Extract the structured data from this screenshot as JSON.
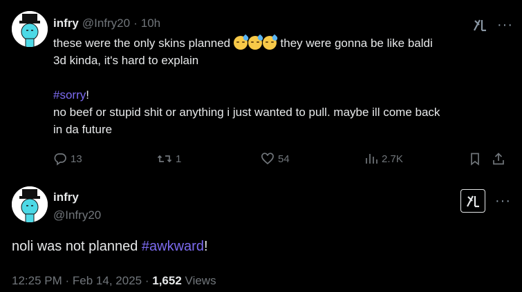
{
  "tweet1": {
    "author_name": "infry",
    "author_handle": "@Infry20",
    "separator": "·",
    "age": "10h",
    "line1_before": "these were the only skins planned ",
    "line1_after": " they were gonna be like baldi",
    "line2": "3d kinda, it's hard to explain",
    "hashtag": "#sorry",
    "hashtag_suffix": "!",
    "line3": "no beef or stupid shit or anything i just wanted to pull. maybe ill come back",
    "line4": "in da future",
    "emojis": [
      "downcast-face-with-sweat-icon",
      "downcast-face-with-sweat-icon",
      "downcast-face-with-sweat-icon"
    ],
    "stats": {
      "replies": "13",
      "reposts": "1",
      "likes": "54",
      "views": "2.7K"
    }
  },
  "tweet2": {
    "author_name": "infry",
    "author_handle": "@Infry20",
    "text_before": "noli was not planned ",
    "hashtag": "#awkward",
    "text_after": "!",
    "time": "12:25 PM",
    "date_sep": "·",
    "date": "Feb 14, 2025",
    "views_sep": "·",
    "views_count": "1,652",
    "views_label": "Views"
  },
  "icons": {
    "grok": "grok-icon",
    "more": "more-icon",
    "reply": "reply-icon",
    "repost": "repost-icon",
    "like": "like-icon",
    "views": "views-icon",
    "bookmark": "bookmark-icon",
    "share": "share-icon"
  },
  "colors": {
    "background": "#000000",
    "text": "#e7e9ea",
    "muted": "#71767b",
    "hashtag": "#7c6bf0",
    "avatar_accent": "#4dd9e6"
  }
}
